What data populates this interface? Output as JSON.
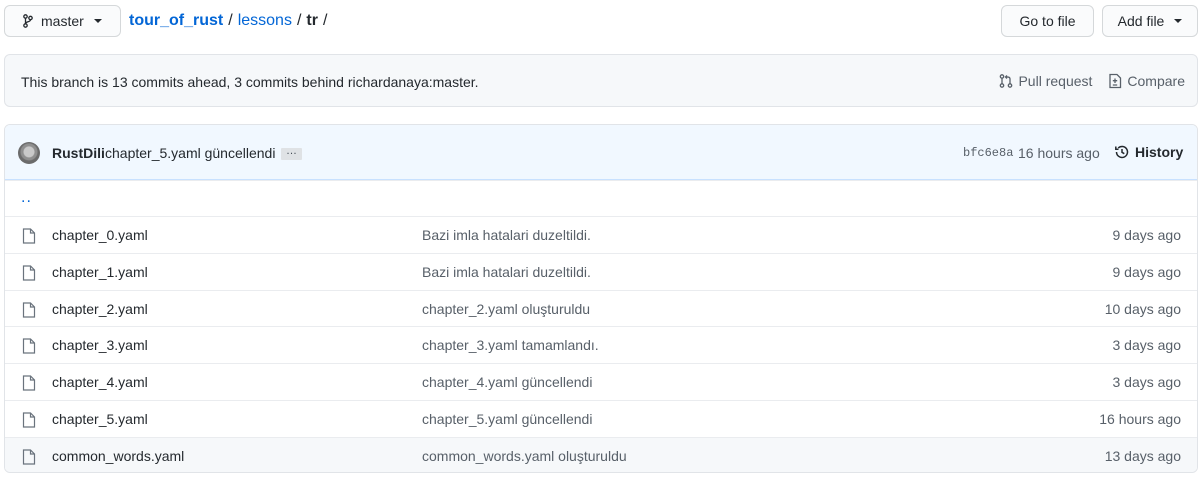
{
  "branch": {
    "name": "master"
  },
  "breadcrumb": {
    "repo": "tour_of_rust",
    "sep1": "/",
    "folder": "lessons",
    "sep2": "/",
    "current": "tr",
    "sep3": "/"
  },
  "buttons": {
    "go_to_file": "Go to file",
    "add_file": "Add file"
  },
  "branch_info": {
    "message": "This branch is 13 commits ahead, 3 commits behind richardanaya:master.",
    "pull_request": "Pull request",
    "compare": "Compare"
  },
  "latest_commit": {
    "author": "RustDili",
    "message": "chapter_5.yaml güncellendi",
    "ellipsis": "…",
    "sha": "bfc6e8a",
    "time": "16 hours ago",
    "history": "History"
  },
  "parent_dir": "..",
  "files": [
    {
      "name": "chapter_0.yaml",
      "message": "Bazi imla hatalari duzeltildi.",
      "age": "9 days ago"
    },
    {
      "name": "chapter_1.yaml",
      "message": "Bazi imla hatalari duzeltildi.",
      "age": "9 days ago"
    },
    {
      "name": "chapter_2.yaml",
      "message": "chapter_2.yaml oluşturuldu",
      "age": "10 days ago"
    },
    {
      "name": "chapter_3.yaml",
      "message": "chapter_3.yaml tamamlandı.",
      "age": "3 days ago"
    },
    {
      "name": "chapter_4.yaml",
      "message": "chapter_4.yaml güncellendi",
      "age": "3 days ago"
    },
    {
      "name": "chapter_5.yaml",
      "message": "chapter_5.yaml güncellendi",
      "age": "16 hours ago"
    },
    {
      "name": "common_words.yaml",
      "message": "common_words.yaml oluşturuldu",
      "age": "13 days ago"
    }
  ],
  "colors": {
    "link": "#0366d6",
    "commit_bar_bg": "#f1f8ff",
    "muted": "#586069"
  },
  "icons": [
    "git-branch-icon",
    "caret-down-icon",
    "pull-request-icon",
    "compare-icon",
    "history-icon",
    "file-icon"
  ]
}
